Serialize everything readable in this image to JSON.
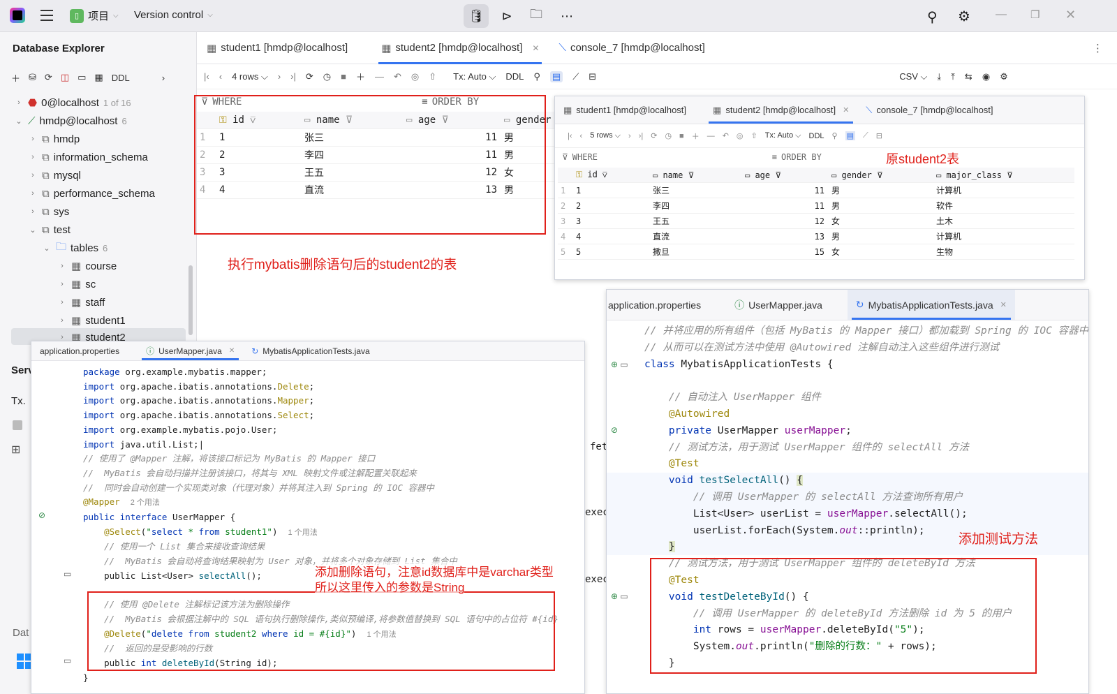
{
  "titlebar": {
    "project_label": "项目",
    "vcs_label": "Version control",
    "colors": {
      "bg": "#ececf0",
      "accent": "#3574f0"
    }
  },
  "sidebar": {
    "title": "Database Explorer",
    "ddl_label": "DDL",
    "tree": [
      {
        "label": "0@localhost",
        "badge": "1 of 16",
        "level": 0
      },
      {
        "label": "hmdp@localhost",
        "badge": "6",
        "level": 0
      },
      {
        "label": "hmdp",
        "level": 1
      },
      {
        "label": "information_schema",
        "level": 1
      },
      {
        "label": "mysql",
        "level": 1
      },
      {
        "label": "performance_schema",
        "level": 1
      },
      {
        "label": "sys",
        "level": 1
      },
      {
        "label": "test",
        "level": 1
      },
      {
        "label": "tables",
        "badge": "6",
        "level": 2
      },
      {
        "label": "course",
        "level": 3
      },
      {
        "label": "sc",
        "level": 3
      },
      {
        "label": "staff",
        "level": 3
      },
      {
        "label": "student1",
        "level": 3
      },
      {
        "label": "student2",
        "level": 3
      }
    ],
    "services_label": "Serv",
    "tx_label": "Tx.",
    "dat_label": "Dat"
  },
  "main": {
    "tabs": [
      "student1 [hmdp@localhost]",
      "student2 [hmdp@localhost]",
      "console_7 [hmdp@localhost]"
    ],
    "rows_label": "4 rows",
    "tx_label": "Tx: Auto",
    "ddl_label": "DDL",
    "csv_label": "CSV",
    "where_label": "WHERE",
    "orderby_label": "ORDER BY",
    "columns": [
      "id",
      "name",
      "age",
      "gender"
    ],
    "rows": [
      [
        "1",
        "1",
        "张三",
        "11",
        "男"
      ],
      [
        "2",
        "2",
        "李四",
        "11",
        "男"
      ],
      [
        "3",
        "3",
        "王五",
        "12",
        "女"
      ],
      [
        "4",
        "4",
        "直流",
        "13",
        "男"
      ]
    ],
    "annotation": "执行mybatis删除语句后的student2的表",
    "side_code": [
      "fet",
      "exec",
      "exec"
    ]
  },
  "popup_table": {
    "tabs": [
      "student1 [hmdp@localhost]",
      "student2 [hmdp@localhost]",
      "console_7 [hmdp@localhost]"
    ],
    "rows_label": "5 rows",
    "tx_label": "Tx: Auto",
    "ddl_label": "DDL",
    "where_label": "WHERE",
    "orderby_label": "ORDER BY",
    "annotation": "原student2表",
    "columns": [
      "id",
      "name",
      "age",
      "gender",
      "major_class"
    ],
    "rows": [
      [
        "1",
        "1",
        "张三",
        "11",
        "男",
        "计算机"
      ],
      [
        "2",
        "2",
        "李四",
        "11",
        "男",
        "软件"
      ],
      [
        "3",
        "3",
        "王五",
        "12",
        "女",
        "土木"
      ],
      [
        "4",
        "4",
        "直流",
        "13",
        "男",
        "计算机"
      ],
      [
        "5",
        "5",
        "撒旦",
        "15",
        "女",
        "生物"
      ]
    ]
  },
  "mapper_editor": {
    "tabs": [
      "application.properties",
      "UserMapper.java",
      "MybatisApplicationTests.java"
    ],
    "lines": [
      "package org.example.mybatis.mapper;",
      "import org.apache.ibatis.annotations.Delete;",
      "import org.apache.ibatis.annotations.Mapper;",
      "import org.apache.ibatis.annotations.Select;",
      "import org.example.mybatis.pojo.User;",
      "import java.util.List;",
      "// 使用了 @Mapper 注解，将该接口标记为 MyBatis 的 Mapper 接口",
      "//  MyBatis 会自动扫描并注册该接口，将其与 XML 映射文件或注解配置关联起来",
      "//  同时会自动创建一个实现类对象（代理对象）并将其注入到 Spring 的 IOC 容器中",
      "@Mapper",
      "public interface UserMapper {",
      "    @Select(\"select * from student1\")",
      "    // 使用一个 List 集合来接收查询结果",
      "    //  MyBatis 会自动将查询结果映射为 User 对象，并将多个对象存储到 List 集合中",
      "    public List<User> selectAll();",
      "",
      "    // 使用 @Delete 注解标记该方法为删除操作",
      "    //  MyBatis 会根据注解中的 SQL 语句执行删除操作,类似预编译,将参数值替换到 SQL 语句中的占位符 #{id}",
      "    @Delete(\"delete from student2 where id = #{id}\")",
      "    //  返回的是受影响的行数",
      "    public int deleteById(String id);",
      "}"
    ],
    "usage_hint_mapper": "2 个用法",
    "usage_hint_select": "1 个用法",
    "usage_hint_delete": "1 个用法",
    "annotation_line1": "添加删除语句，注意id数据库中是varchar类型",
    "annotation_line2": "所以这里传入的参数是String"
  },
  "test_editor": {
    "tabs": [
      "application.properties",
      "UserMapper.java",
      "MybatisApplicationTests.java"
    ],
    "lines": [
      "// 并将应用的所有组件（包括 MyBatis 的 Mapper 接口）都加载到 Spring 的 IOC 容器中",
      "// 从而可以在测试方法中使用 @Autowired 注解自动注入这些组件进行测试",
      "class MybatisApplicationTests {",
      "",
      "    // 自动注入 UserMapper 组件",
      "    @Autowired",
      "    private UserMapper userMapper;",
      "    // 测试方法，用于测试 UserMapper 组件的 selectAll 方法",
      "    @Test",
      "    void testSelectAll() {",
      "        // 调用 UserMapper 的 selectAll 方法查询所有用户",
      "        List<User> userList = userMapper.selectAll();",
      "        userList.forEach(System.out::println);",
      "    }",
      "    // 测试方法，用于测试 UserMapper 组件的 deleteById 方法",
      "    @Test",
      "    void testDeleteById() {",
      "        // 调用 UserMapper 的 deleteById 方法删除 id 为 5 的用户",
      "        int rows = userMapper.deleteById(\"5\");",
      "        System.out.println(\"删除的行数：\" + rows);",
      "    }"
    ],
    "annotation": "添加测试方法"
  }
}
